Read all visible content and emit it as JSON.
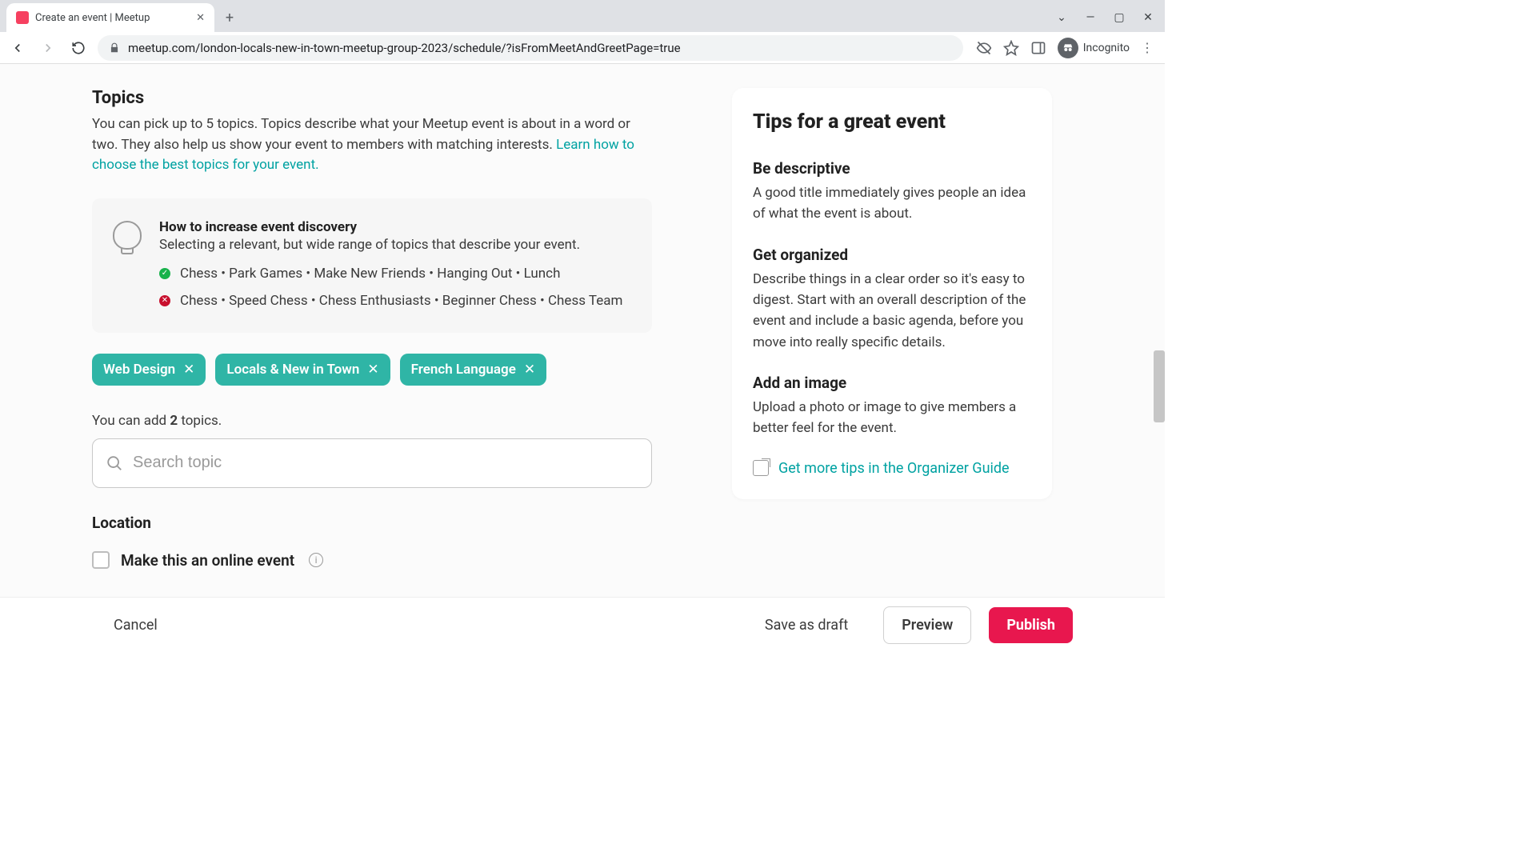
{
  "browser": {
    "tab_title": "Create an event | Meetup",
    "url": "meetup.com/london-locals-new-in-town-meetup-group-2023/schedule/?isFromMeetAndGreetPage=true",
    "incognito_label": "Incognito"
  },
  "topics": {
    "heading": "Topics",
    "description": "You can pick up to 5 topics. Topics describe what your Meetup event is about in a word or two. They also help us show your event to members with matching interests. ",
    "learn_link": "Learn how to choose the best topics for your event.",
    "tip_title": "How to increase event discovery",
    "tip_sub": "Selecting a relevant, but wide range of topics that describe your event.",
    "good_example": "Chess • Park Games • Make New Friends • Hanging Out • Lunch",
    "bad_example": "Chess • Speed Chess • Chess Enthusiasts • Beginner Chess • Chess Team",
    "chips": [
      "Web Design",
      "Locals & New in Town",
      "French Language"
    ],
    "add_count_prefix": "You can add ",
    "add_count_num": "2",
    "add_count_suffix": " topics.",
    "search_placeholder": "Search topic"
  },
  "location": {
    "heading": "Location",
    "online_label": "Make this an online event"
  },
  "tips": {
    "panel_title": "Tips for a great event",
    "t1_h": "Be descriptive",
    "t1_p": "A good title immediately gives people an idea of what the event is about.",
    "t2_h": "Get organized",
    "t2_p": "Describe things in a clear order so it's easy to digest. Start with an overall description of the event and include a basic agenda, before you move into really specific details.",
    "t3_h": "Add an image",
    "t3_p": "Upload a photo or image to give members a better feel for the event.",
    "guide_link": "Get more tips in the Organizer Guide"
  },
  "footer": {
    "cancel": "Cancel",
    "save_draft": "Save as draft",
    "preview": "Preview",
    "publish": "Publish"
  }
}
